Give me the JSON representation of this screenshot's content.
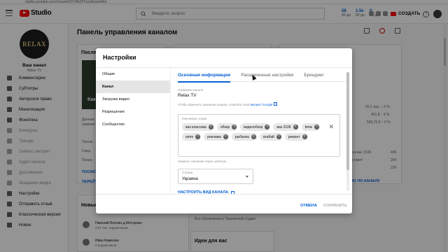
{
  "browser": {
    "url": "studio.youtube.com/channel/UC4Ib2FCwo8s/a/editor"
  },
  "header": {
    "logo_text": "Studio",
    "search_placeholder": "Введите запрос",
    "stats": [
      {
        "value": "58",
        "label": "90 дн."
      },
      {
        "value": "1.5к",
        "label": "90 дн."
      },
      {
        "value": "0",
        "label": "90 дн."
      }
    ],
    "create_label": "СОЗДАТЬ"
  },
  "sidebar": {
    "avatar_text": "RELAX",
    "channel_name": "Ваш канал",
    "channel_sub": "Relax TV",
    "items": [
      {
        "label": "Комментарии",
        "icon": "comment-icon",
        "faded": false
      },
      {
        "label": "Субтитры",
        "icon": "subtitles-icon",
        "faded": false
      },
      {
        "label": "Авторское право",
        "icon": "copyright-icon",
        "faded": false
      },
      {
        "label": "Монетизация",
        "icon": "money-icon",
        "faded": false
      },
      {
        "label": "Фонотека",
        "icon": "audio-icon",
        "faded": false
      },
      {
        "label": "Конкурсы",
        "icon": "contest-icon",
        "faded": true
      },
      {
        "label": "Тренды",
        "icon": "trend-icon",
        "faded": true
      },
      {
        "label": "Сейчас смотрят",
        "icon": "live-icon",
        "faded": true
      },
      {
        "label": "Аудит канала",
        "icon": "audit-icon",
        "faded": true
      },
      {
        "label": "Достижения",
        "icon": "trophy-icon",
        "faded": true
      },
      {
        "label": "Академия видео",
        "icon": "academy-icon",
        "faded": true
      },
      {
        "label": "Настройки",
        "icon": "gear-icon",
        "faded": false
      },
      {
        "label": "Отправить отзыв",
        "icon": "feedback-icon",
        "faded": false
      },
      {
        "label": "Классическая версия",
        "icon": "classic-icon",
        "faded": false
      },
      {
        "label": "Новое",
        "icon": "new-icon",
        "faded": false
      }
    ]
  },
  "dashboard": {
    "title": "Панель управления каналом",
    "card1_title": "После",
    "card1_video_text": "Как",
    "card1_desc_1": "Данные",
    "card1_desc_2": "сравнен",
    "card1_row_1": "Просм",
    "card1_row_2": "Сред",
    "card1_row_3": "Понра",
    "card1_link_1": "ПОСМО",
    "card1_link_2": "ПЕРЕЙТ",
    "card3_values": [
      "20,1 тыс. ↓ 3 %",
      "451,8 ↓ 4 %",
      "599,70 ₽ ↑ 6 %"
    ],
    "card3_rows": [
      "на вас 2106",
      "ставят",
      ""
    ],
    "card3_nums": [
      "406",
      "254",
      "224"
    ],
    "card3_link": "Ю ПО КАНАЛУ",
    "new_title": "Новые",
    "subscriber_1": "Николай Блохин д.Моторово",
    "subscriber_1_meta": "2,67 тыс. подписчиков",
    "subscriber_2": "Иван Каменюк",
    "subscriber_2_meta": "0 подписчиков",
    "card2_note": "Все обновления в Творческой студии",
    "ideas_title": "Идеи для вас"
  },
  "dialog": {
    "title": "Настройки",
    "side_items": [
      {
        "label": "Общие",
        "active": false
      },
      {
        "label": "Канал",
        "active": true
      },
      {
        "label": "Загрузка видео",
        "active": false
      },
      {
        "label": "Разрешения",
        "active": false
      },
      {
        "label": "Сообщество",
        "active": false
      }
    ],
    "tabs": [
      {
        "label": "Основная информация",
        "active": true
      },
      {
        "label": "Расширенные настройки",
        "active": false
      },
      {
        "label": "Брендинг",
        "active": false
      }
    ],
    "name_label": "Название канала",
    "name_value": "Relax TV",
    "name_hint": "Чтобы изменить название канала, откройте свой",
    "name_hint_link": "аккаунт Google",
    "keywords_label": "Ключевые слова",
    "keywords": [
      "ваз классика",
      "обзор",
      "видеообзор",
      "ваз 2106",
      "bmw",
      "amm",
      "реклама",
      "рыбалка",
      "атабай",
      "ремонт"
    ],
    "keywords_hint": "Укажите значения через запятую.",
    "country_label": "Страна",
    "country_value": "Украина",
    "setup_link": "НАСТРОИТЬ ВИД КАНАЛА",
    "cancel_label": "ОТМЕНА",
    "save_label": "СОХРАНИТЬ"
  }
}
